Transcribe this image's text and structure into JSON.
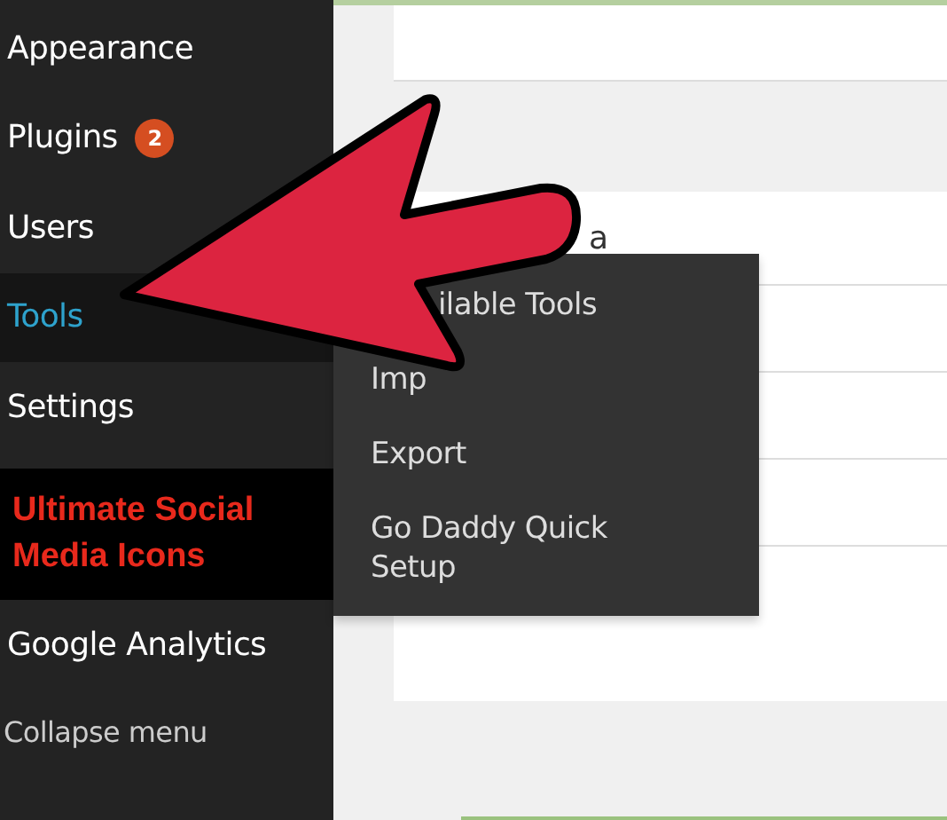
{
  "sidebar": {
    "items": [
      {
        "label": "Appearance",
        "kind": "menu",
        "selected": false
      },
      {
        "label": "Plugins",
        "kind": "menu",
        "selected": false,
        "badge": "2"
      },
      {
        "label": "Users",
        "kind": "menu",
        "selected": false
      },
      {
        "label": "Tools",
        "kind": "menu",
        "selected": true
      },
      {
        "label": "Settings",
        "kind": "menu",
        "selected": false
      },
      {
        "label": "Ultimate Social Media Icons",
        "kind": "promo",
        "selected": false
      },
      {
        "label": "Google Analytics",
        "kind": "menu",
        "selected": false
      }
    ],
    "collapse": "Collapse menu"
  },
  "flyout": {
    "items": [
      "ilable Tools",
      "Imp",
      "Export",
      "Go Daddy Quick Setup"
    ]
  },
  "content": {
    "heading_fragment": "a"
  }
}
